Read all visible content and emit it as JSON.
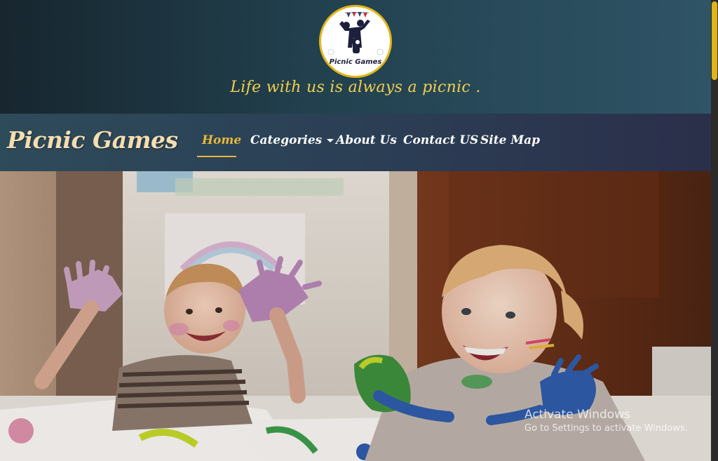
{
  "header": {
    "logo_text": "Picnic Games",
    "tagline": "Life with us is always a picnic ."
  },
  "navbar": {
    "brand": "Picnic Games",
    "items": [
      {
        "label": "Home",
        "active": true
      },
      {
        "label": "Categories",
        "dropdown": true
      },
      {
        "label": "About Us"
      },
      {
        "label": "Contact US"
      },
      {
        "label": "Site Map"
      }
    ]
  },
  "watermark": {
    "title": "Activate Windows",
    "subtitle": "Go to Settings to activate Windows."
  },
  "colors": {
    "accent": "#e9b73a",
    "brand_text": "#f4ddb0",
    "tagline": "#f2cf4d"
  }
}
